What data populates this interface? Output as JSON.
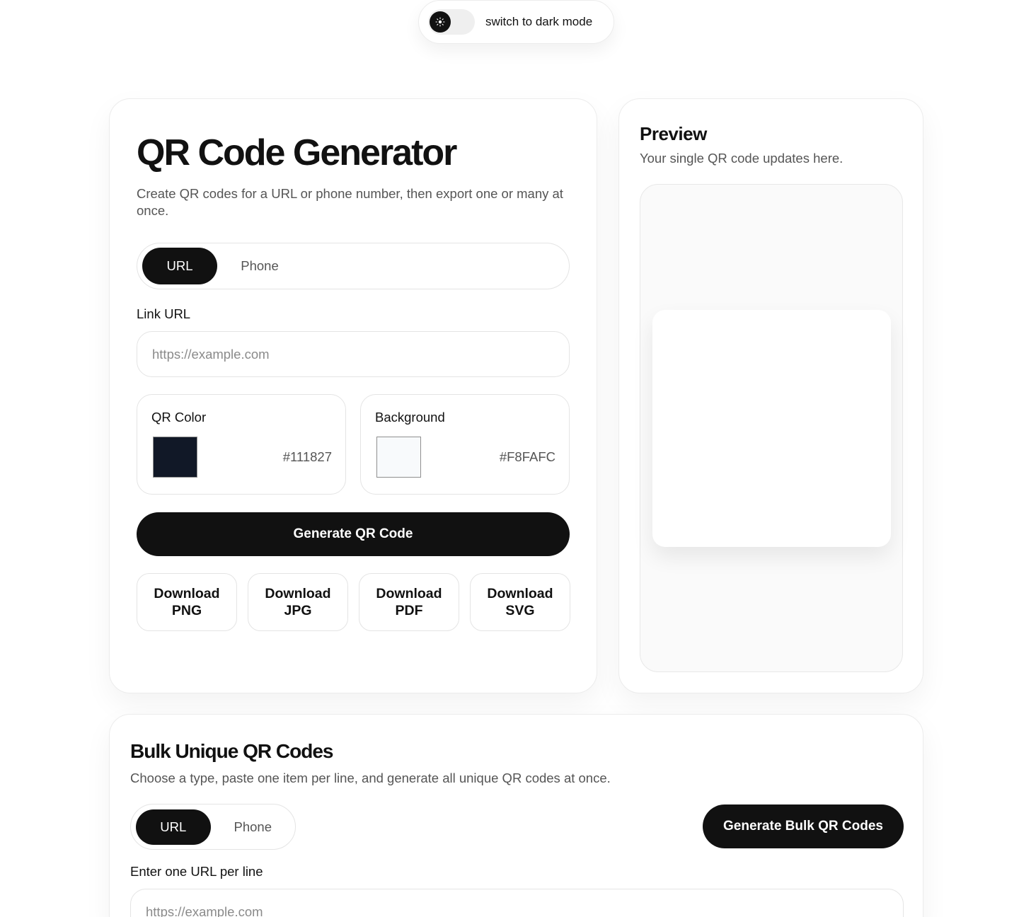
{
  "theme_toggle": {
    "label": "switch to dark mode"
  },
  "generator": {
    "title": "QR Code Generator",
    "subtitle": "Create QR codes for a URL or phone number, then export one or many at once.",
    "tabs": [
      {
        "label": "URL",
        "active": true
      },
      {
        "label": "Phone",
        "active": false
      }
    ],
    "link_label": "Link URL",
    "link_placeholder": "https://example.com",
    "qr_color": {
      "label": "QR Color",
      "value": "#111827"
    },
    "background_color": {
      "label": "Background",
      "value": "#F8FAFC"
    },
    "generate_label": "Generate QR Code",
    "downloads": [
      "Download\nPNG",
      "Download\nJPG",
      "Download\nPDF",
      "Download\nSVG"
    ]
  },
  "preview": {
    "title": "Preview",
    "subtitle": "Your single QR code updates here."
  },
  "bulk": {
    "title": "Bulk Unique QR Codes",
    "subtitle": "Choose a type, paste one item per line, and generate all unique QR codes at once.",
    "tabs": [
      {
        "label": "URL",
        "active": true
      },
      {
        "label": "Phone",
        "active": false
      }
    ],
    "generate_label": "Generate Bulk QR Codes",
    "input_label": "Enter one URL per line",
    "input_placeholder": "https://example.com"
  },
  "colors": {
    "accent": "#111111",
    "muted_text": "#555555",
    "border": "#e4e4e4"
  }
}
